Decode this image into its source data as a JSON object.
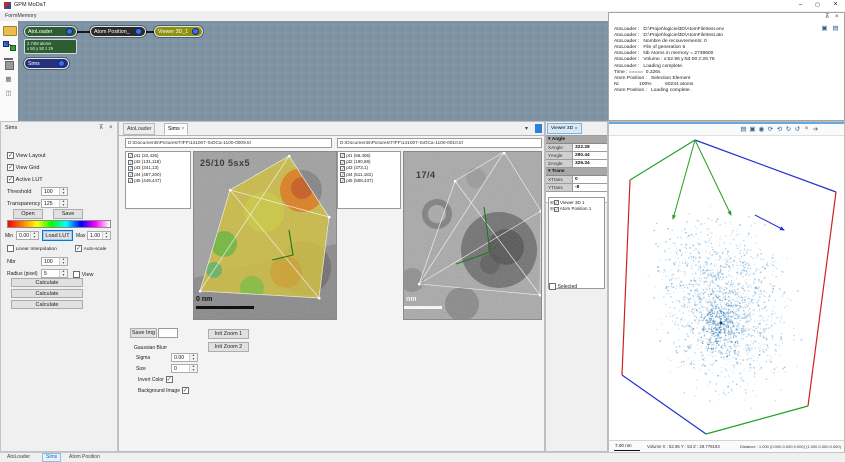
{
  "window": {
    "title": "GPM MoDaT",
    "minimize_glyph": "–",
    "maximize_glyph": "▢",
    "close_glyph": "×"
  },
  "menu": {
    "formmemory_label": "FormMemory"
  },
  "node_graph": {
    "atoloader": {
      "label": "AtoLoader",
      "info_line1": "2.74M atoms",
      "info_line2": "x 50 y 50 z 29"
    },
    "atom_position": {
      "label": "Atom Position_"
    },
    "viewer3d": {
      "label": "Viewer 3D_1"
    },
    "sims": {
      "label": "Sims"
    }
  },
  "log": {
    "lines": [
      "AtoLoader :   D:\\Projet\\logiciel3D\\AtomFile\\test.env",
      "AtoLoader :   D:\\Projet\\logiciel3D\\AtomFile\\test.ato",
      "AtoLoader :   Nombre de recouvrements: 0",
      "AtoLoader :   File of generation 5",
      "AtoLoader :   Nb Atoms in memory = 2739600",
      "AtoLoader :   Volume : x:52.96 y:53.00 z:28.78",
      "AtoLoader :   Loading complete.",
      "Time : =====  0.226s",
      "Atom Position :   Selection Element",
      "Ni               100%          60234 atoms",
      "Atom Position :   Loading complete."
    ]
  },
  "sims_panel": {
    "title": "Sims",
    "view_layout": "View Layout",
    "view_grid": "View Grid",
    "active_lut": "Active LUT",
    "threshold_label": "Threshold",
    "threshold_value": "100",
    "transparency_label": "Transparency",
    "transparency_value": "125",
    "open_label": "Open",
    "save_label": "Save",
    "min_label": "Min",
    "min_value": "0.00",
    "load_lut_label": "Load LUT",
    "max_label": "Max",
    "max_value": "1.00",
    "linear_interpolation": "Linear Interpolation",
    "auto_scale": "Auto-scale",
    "nbr_label": "Nbr",
    "nbr_value": "100",
    "radius_label": "Radius (pixel)",
    "radius_value": "5",
    "view_label": "View",
    "calculate1": "Calculate",
    "calculate2": "Calculate",
    "calculate3": "Calculate"
  },
  "doc_panel": {
    "tab_atoloader": "AtoLoader",
    "tab_sims": "Sims",
    "left": {
      "path": "D:\\Documents\\Pictures\\TIFF\\141007-SiOCa-1100-0009.tif",
      "points": [
        "pt1 (22,426)",
        "pt2 (131,118)",
        "pt3 (341,13)",
        "pt4 (487,200)",
        "pt5 (449,447)"
      ],
      "overlay_label": "25/10 5sx5",
      "scale_label": "0 nm"
    },
    "right": {
      "path": "D:\\Documents\\Pictures\\TIFF\\141007-SiOCa-1100-0010.tif",
      "points": [
        "pt1 (56,406)",
        "pt2 (190,88)",
        "pt3 (373,1)",
        "pt4 (511,181)",
        "pt5 (508,437)"
      ],
      "overlay_label": "17/4",
      "scale_label": "nm"
    },
    "controls": {
      "save_img": "Save Img",
      "gaussian": "Gaussian Blurr",
      "sigma_label": "Sigma",
      "sigma_value": "0.00",
      "size_label": "Size",
      "size_value": "0",
      "invert_color": "Invert Color",
      "background_image": "Background Image",
      "init_zoom_1": "Init Zoom 1",
      "init_zoom_2": "Init Zoom 2"
    }
  },
  "viewer3d_panel": {
    "tab": "Viewer 3D",
    "angle_header": "Angle",
    "xangle_label": "XAngle",
    "xangle_value": "322.28",
    "yangle_label": "YAngle",
    "yangle_value": "290.44",
    "zangle_label": "ZAngle",
    "zangle_value": "326.34",
    "trans_header": "Trans",
    "xtrans_label": "XTrans",
    "xtrans_value": "0",
    "ytrans_label": "YTrans",
    "ytrans_value": "-8",
    "tree_item1": "Viewer 3D 1",
    "tree_item2": "Atom Position 1",
    "selected_label": "Selected"
  },
  "viewport": {
    "toolbar_icons": [
      "▤",
      "▣",
      "◉",
      "⟳",
      "⟲",
      "↻",
      "↺",
      "×",
      "➔"
    ],
    "status": {
      "scale": "7.00 nm",
      "volume": "Volume X : 52.96 Y : 53 Z : 28.778193",
      "distance": "Distance : 1.000    (0.000,0.000,0.000) (1.000,0.000,0.000)"
    }
  },
  "bottom_tabs": {
    "atoloader": "AtoLoader",
    "sims": "Sims",
    "atom_position": "Atom Position"
  },
  "colors": {
    "node_atoloader": "#2e5d32",
    "node_atom_position": "#2b2b2b",
    "node_viewer3d": "#8f8f10",
    "node_sims": "#24307a",
    "canvas_bg": "#7e93a3",
    "accent_blue": "#0078d7",
    "lut_gradient": [
      "#ff0000",
      "#ff8000",
      "#ffff00",
      "#00ff00",
      "#00ffff",
      "#0000ff",
      "#ff00ff",
      "#ffffff"
    ],
    "wire_red": "#cc2222",
    "wire_green": "#22a022",
    "wire_blue": "#2233cc",
    "cloud_blue": "#6fa8d4"
  }
}
